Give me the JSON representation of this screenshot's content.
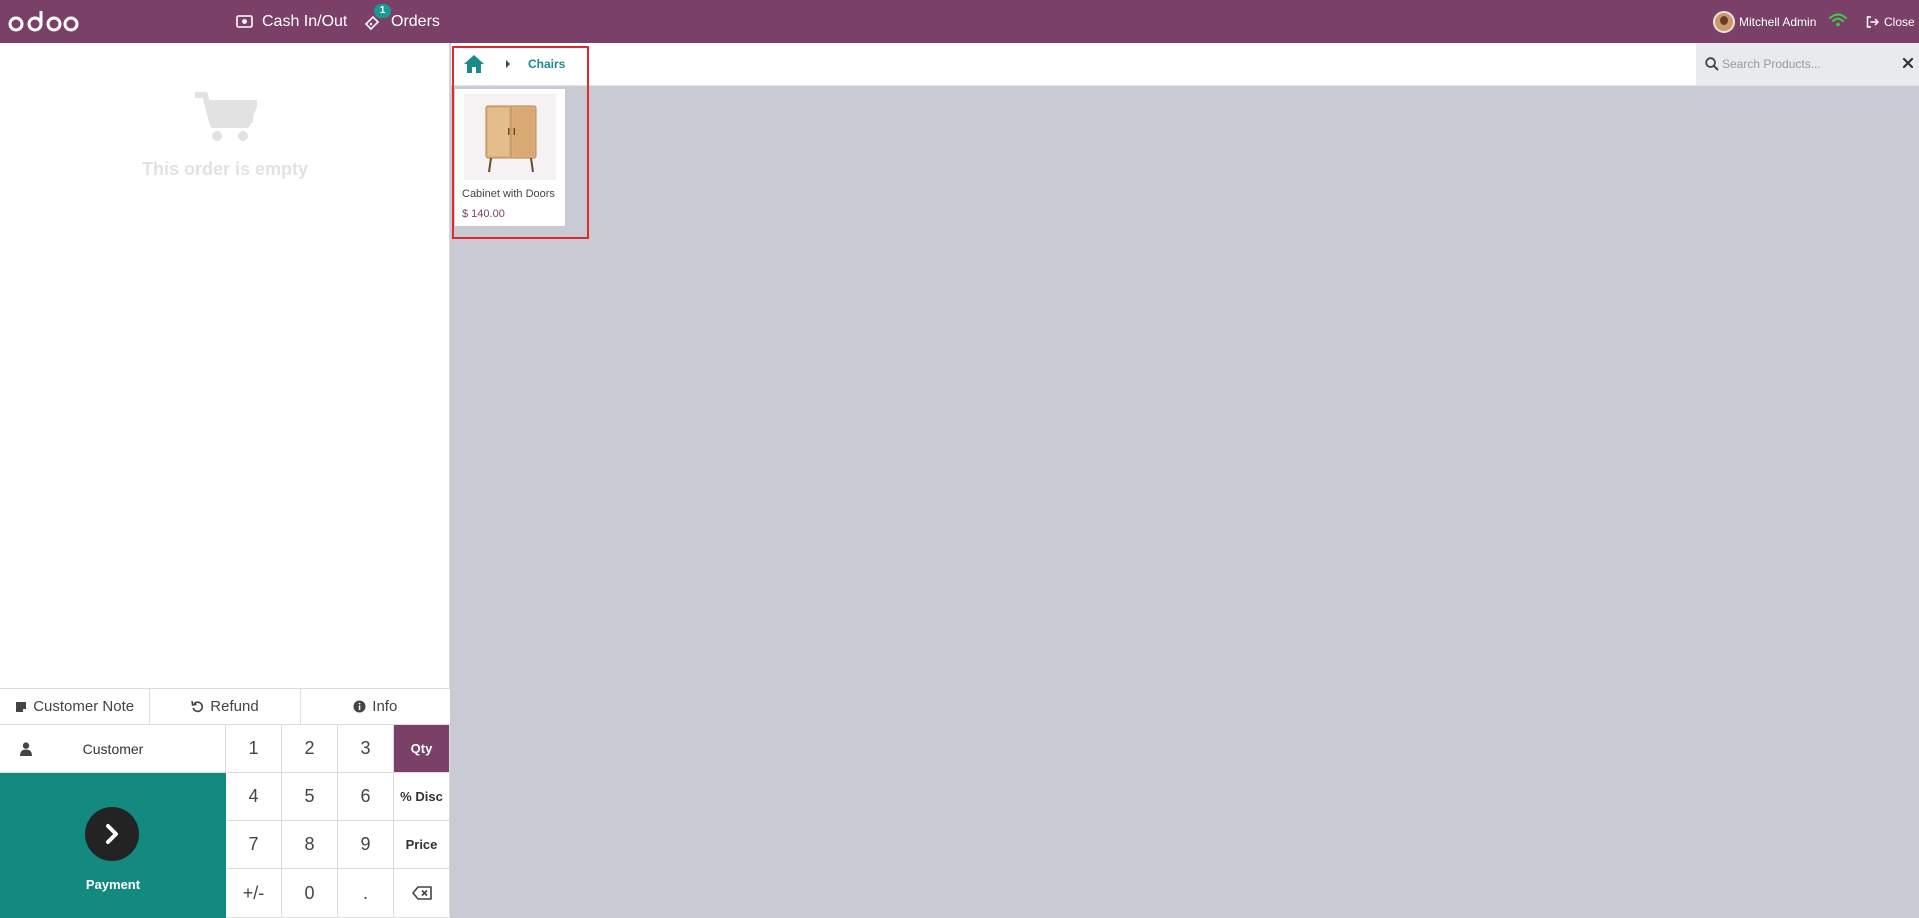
{
  "navbar": {
    "cash_label": "Cash In/Out",
    "orders_label": "Orders",
    "orders_badge": "1",
    "user_name": "Mitchell Admin",
    "close_label": "Close"
  },
  "order": {
    "empty_text": "This order is empty"
  },
  "controls": {
    "customer_note": "Customer Note",
    "refund": "Refund",
    "info": "Info",
    "customer": "Customer",
    "payment": "Payment"
  },
  "numpad": {
    "keys": [
      "1",
      "2",
      "3",
      "Qty",
      "4",
      "5",
      "6",
      "% Disc",
      "7",
      "8",
      "9",
      "Price",
      "+/-",
      "0",
      "."
    ],
    "active_mode": "Qty"
  },
  "breadcrumb": {
    "category": "Chairs"
  },
  "search": {
    "placeholder": "Search Products..."
  },
  "products": [
    {
      "name": "Cabinet with Doors",
      "price": "$ 140.00"
    }
  ],
  "colors": {
    "brand": "#7b4068",
    "accent": "#13897f",
    "highlight": "#e0282d"
  }
}
